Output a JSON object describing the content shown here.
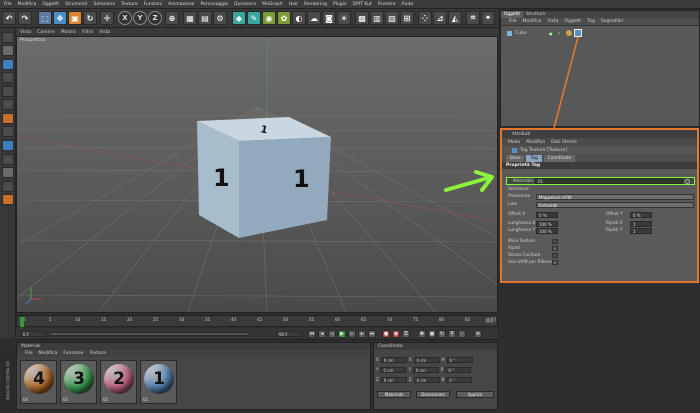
{
  "menubar": [
    "File",
    "Modifica",
    "Oggetti",
    "Strumenti",
    "Selezione",
    "Texture",
    "Funzioni",
    "Animazione",
    "Personaggio",
    "Dynamics",
    "MoGraph",
    "Hair",
    "Rendering",
    "Plugin",
    "DPIT Kut",
    "Finestre",
    "Aiuto"
  ],
  "toolbar": {
    "axis_x": "X",
    "axis_y": "Y",
    "axis_z": "Z"
  },
  "viewport": {
    "menu": [
      "Vista",
      "Camere",
      "Mostra",
      "Filtro",
      "Vista"
    ],
    "label": "Prospettiva",
    "cube_faces": [
      "1",
      "1",
      "1"
    ]
  },
  "objects_panel": {
    "tabs": [
      "Oggetti",
      "Strutture"
    ],
    "menu": [
      "File",
      "Modifica",
      "Vista",
      "Oggetti",
      "Tag",
      "Segnalibri"
    ],
    "object_name": "Cubo"
  },
  "attributes": {
    "header": "Attributi",
    "menu": [
      "Modo",
      "Modifica",
      "Dati Utente"
    ],
    "title": "Tag Texture [Texture]",
    "tabs": [
      "Base",
      "Tag",
      "Coordinate"
    ],
    "section": "Proprietà Tag",
    "material_label": "Materiale",
    "material_value": "01",
    "selection_label": "Selezione",
    "projection_label": "Proiezione",
    "projection_value": "Mappatura UVW",
    "side_label": "Lato",
    "side_value": "Entrambi",
    "offset_x_label": "Offset X",
    "offset_x_value": "0 %",
    "offset_y_label": "Offset Y",
    "offset_y_value": "0 %",
    "length_x_label": "Lunghezza X",
    "length_x_value": "100 %",
    "length_y_label": "Lunghezza Y",
    "length_y_value": "100 %",
    "tiles_x_label": "Ripeti X",
    "tiles_x_value": "1",
    "tiles_y_label": "Ripeti Y",
    "tiles_y_value": "1",
    "mix_label": "Mixa Texture",
    "tile_label": "Ripeti",
    "tile_checked": "✓",
    "seamless_label": "Senza Cuciture",
    "uvw_label": "Usa UVW per Rilievo",
    "uvw_checked": "✓"
  },
  "timeline": {
    "ticks": [
      "0",
      "5",
      "10",
      "15",
      "20",
      "25",
      "30",
      "35",
      "40",
      "45",
      "50",
      "55",
      "60",
      "65",
      "70",
      "75",
      "80",
      "85",
      "90"
    ],
    "frame_start": "0 F",
    "frame_end": "90 F",
    "end_indicator": "0 F"
  },
  "materials": {
    "header": "Materiali",
    "menu": [
      "File",
      "Modifica",
      "Funzione",
      "Texture"
    ],
    "items": [
      {
        "number": "4",
        "name": "04",
        "color": "#c8772e"
      },
      {
        "number": "3",
        "name": "03",
        "color": "#3eae5a"
      },
      {
        "number": "2",
        "name": "02",
        "color": "#d46a8e"
      },
      {
        "number": "1",
        "name": "01",
        "color": "#5b8fc4"
      }
    ]
  },
  "coordinates": {
    "header": "Coordinate",
    "rows": [
      {
        "axis": "X",
        "pos": "0 cm",
        "size": "0 cm",
        "rot_label": "H",
        "rot": "0 °"
      },
      {
        "axis": "Y",
        "pos": "0 cm",
        "size": "0 cm",
        "rot_label": "P",
        "rot": "0 °"
      },
      {
        "axis": "Z",
        "pos": "0 cm",
        "size": "0 cm",
        "rot_label": "B",
        "rot": "0 °"
      }
    ],
    "mode_button": "Materiale",
    "size_button": "Dimensione",
    "apply_button": "Applica"
  },
  "badge": "MAXON CINEMA 4D",
  "colors": {
    "highlight_orange": "#e0782b",
    "arrow_green": "#8cf23a",
    "selection_blue": "#8aa3c2"
  }
}
